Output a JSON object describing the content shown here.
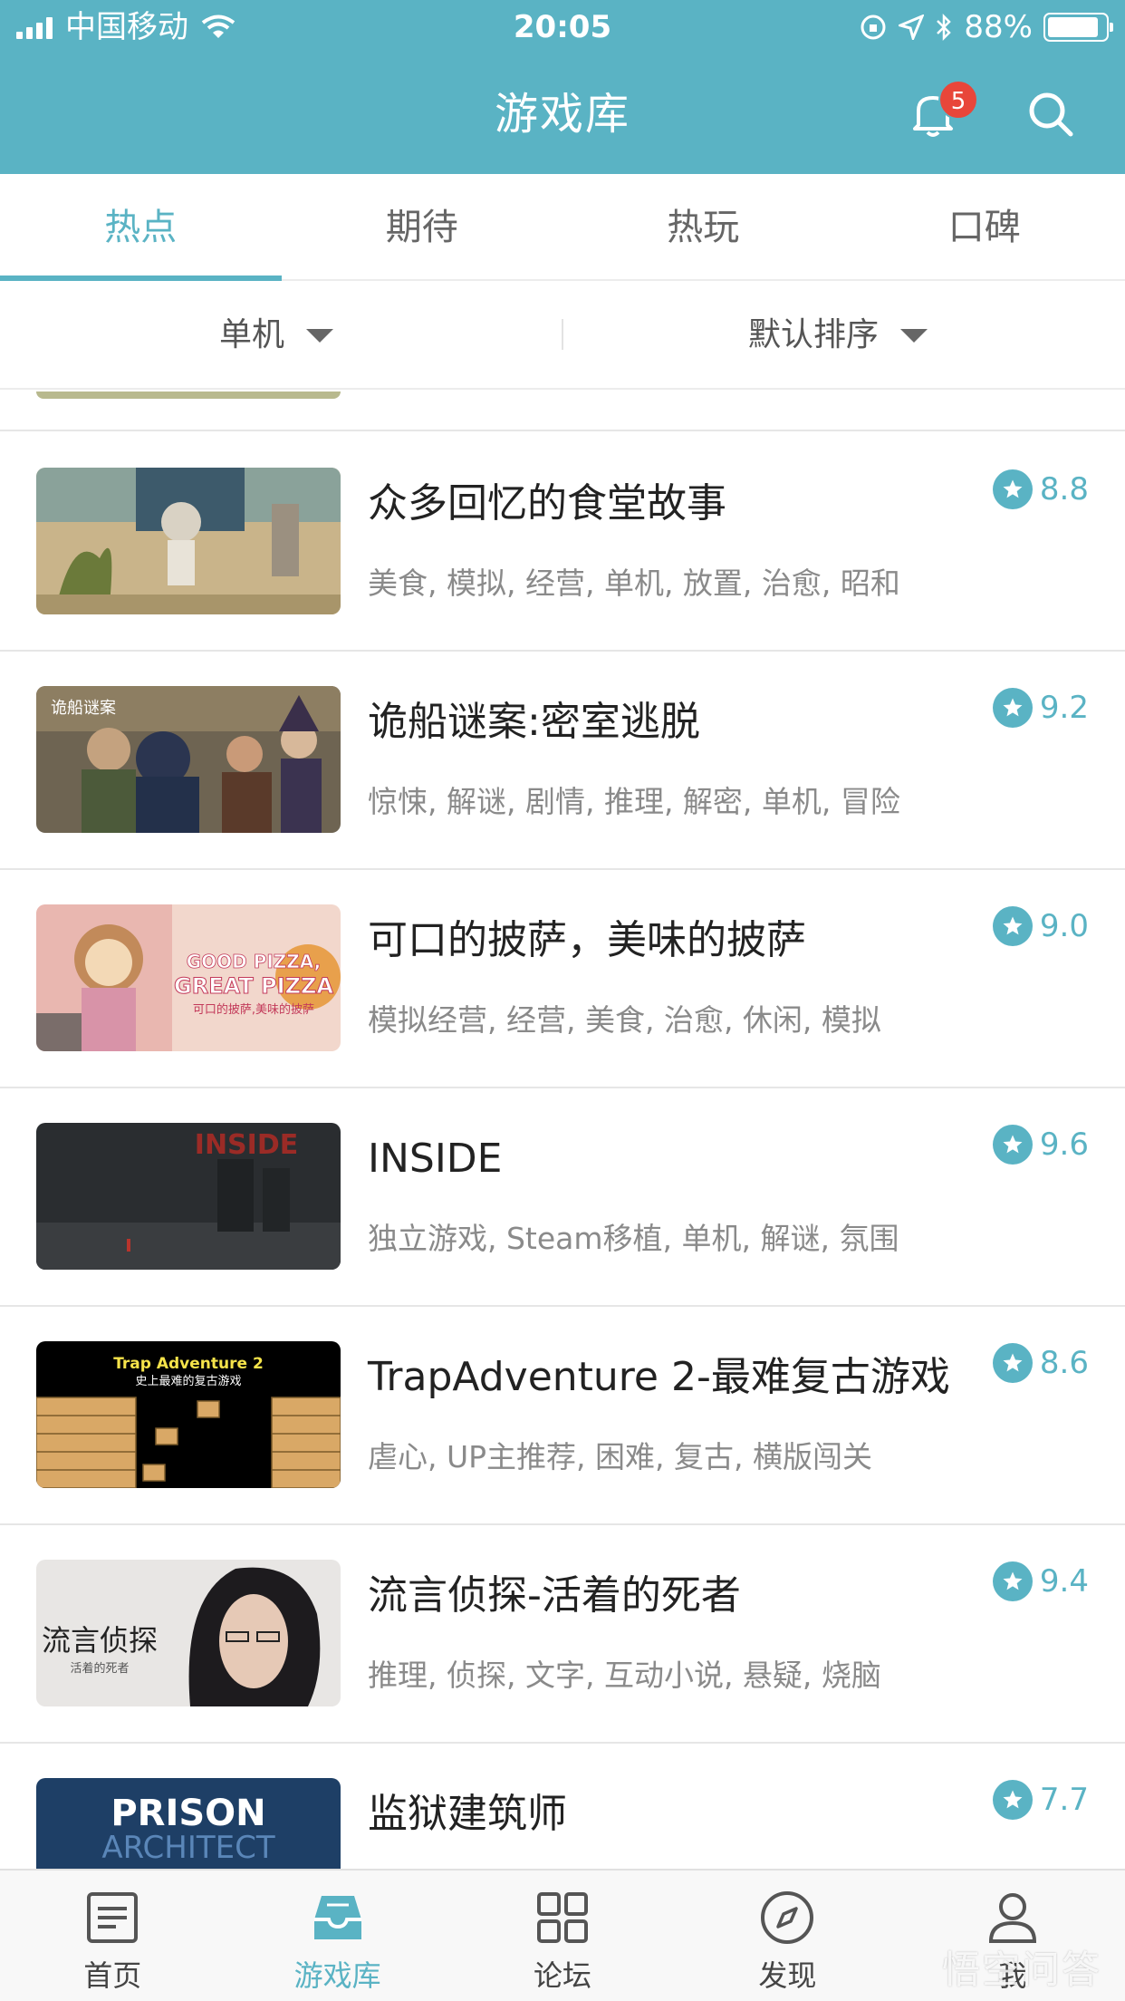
{
  "status_bar": {
    "carrier": "中国移动",
    "time": "20:05",
    "battery": "88%",
    "battery_level": 0.88
  },
  "header": {
    "title": "游戏库",
    "notification_count": "5"
  },
  "tabs": [
    {
      "label": "热点",
      "active": true
    },
    {
      "label": "期待",
      "active": false
    },
    {
      "label": "热玩",
      "active": false
    },
    {
      "label": "口碑",
      "active": false
    }
  ],
  "filters": {
    "platform": "单机",
    "sort": "默认排序"
  },
  "games": [
    {
      "title": "众多回忆的食堂故事",
      "tags": "美食, 模拟, 经营, 单机, 放置, 治愈, 昭和",
      "rating": "8.8"
    },
    {
      "title": "诡船谜案:密室逃脱",
      "tags": "惊悚, 解谜, 剧情, 推理, 解密, 单机, 冒险",
      "rating": "9.2"
    },
    {
      "title": "可口的披萨，美味的披萨",
      "tags": "模拟经营, 经营, 美食, 治愈, 休闲, 模拟",
      "rating": "9.0"
    },
    {
      "title": "INSIDE",
      "tags": "独立游戏, Steam移植, 单机, 解谜, 氛围",
      "rating": "9.6"
    },
    {
      "title": "TrapAdventure 2-最难复古游戏",
      "tags": "虐心, UP主推荐, 困难, 复古, 横版闯关",
      "rating": "8.6"
    },
    {
      "title": "流言侦探-活着的死者",
      "tags": "推理, 侦探, 文字, 互动小说, 悬疑, 烧脑",
      "rating": "9.4"
    },
    {
      "title": "监狱建筑师",
      "tags": "",
      "rating": "7.7"
    }
  ],
  "thumb_text": {
    "inside": "INSIDE",
    "pizza_1": "GOOD PIZZA,",
    "pizza_2": "GREAT PIZZA",
    "pizza_3": "可口的披萨,美味的披萨",
    "trap_1": "Trap Adventure 2",
    "trap_2": "史上最难的复古游戏",
    "detective": "流言侦探",
    "detective_sub": "活着的死者",
    "prison_1": "PRISON",
    "prison_2": "ARCHITECT",
    "ship": "诡船谜案"
  },
  "bottom_nav": [
    {
      "label": "首页",
      "icon": "news-icon",
      "active": false
    },
    {
      "label": "游戏库",
      "icon": "inbox-tray-icon",
      "active": true
    },
    {
      "label": "论坛",
      "icon": "grid-icon",
      "active": false
    },
    {
      "label": "发现",
      "icon": "compass-icon",
      "active": false
    },
    {
      "label": "我",
      "icon": "user-icon",
      "active": false
    }
  ],
  "watermark": "悟空问答",
  "colors": {
    "accent": "#5ab3c4",
    "badge": "#e8463a"
  }
}
